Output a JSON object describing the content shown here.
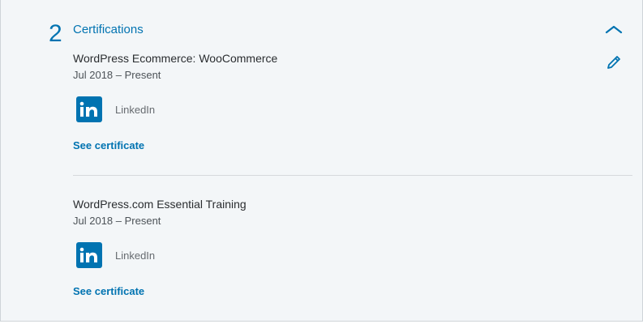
{
  "section": {
    "count": "2",
    "title": "Certifications"
  },
  "certifications": [
    {
      "name": "WordPress Ecommerce: WooCommerce",
      "date": "Jul 2018 – Present",
      "issuer": "LinkedIn",
      "link_label": "See certificate"
    },
    {
      "name": "WordPress.com Essential Training",
      "date": "Jul 2018 – Present",
      "issuer": "LinkedIn",
      "link_label": "See certificate"
    }
  ],
  "icons": {
    "collapse": "chevron-up-icon",
    "edit": "pencil-icon",
    "issuer_logo": "linkedin-logo-icon"
  },
  "colors": {
    "accent": "#0073b1",
    "panel_background": "#f3f6f8",
    "text_primary": "#2a2d30",
    "text_secondary": "#666b70"
  }
}
